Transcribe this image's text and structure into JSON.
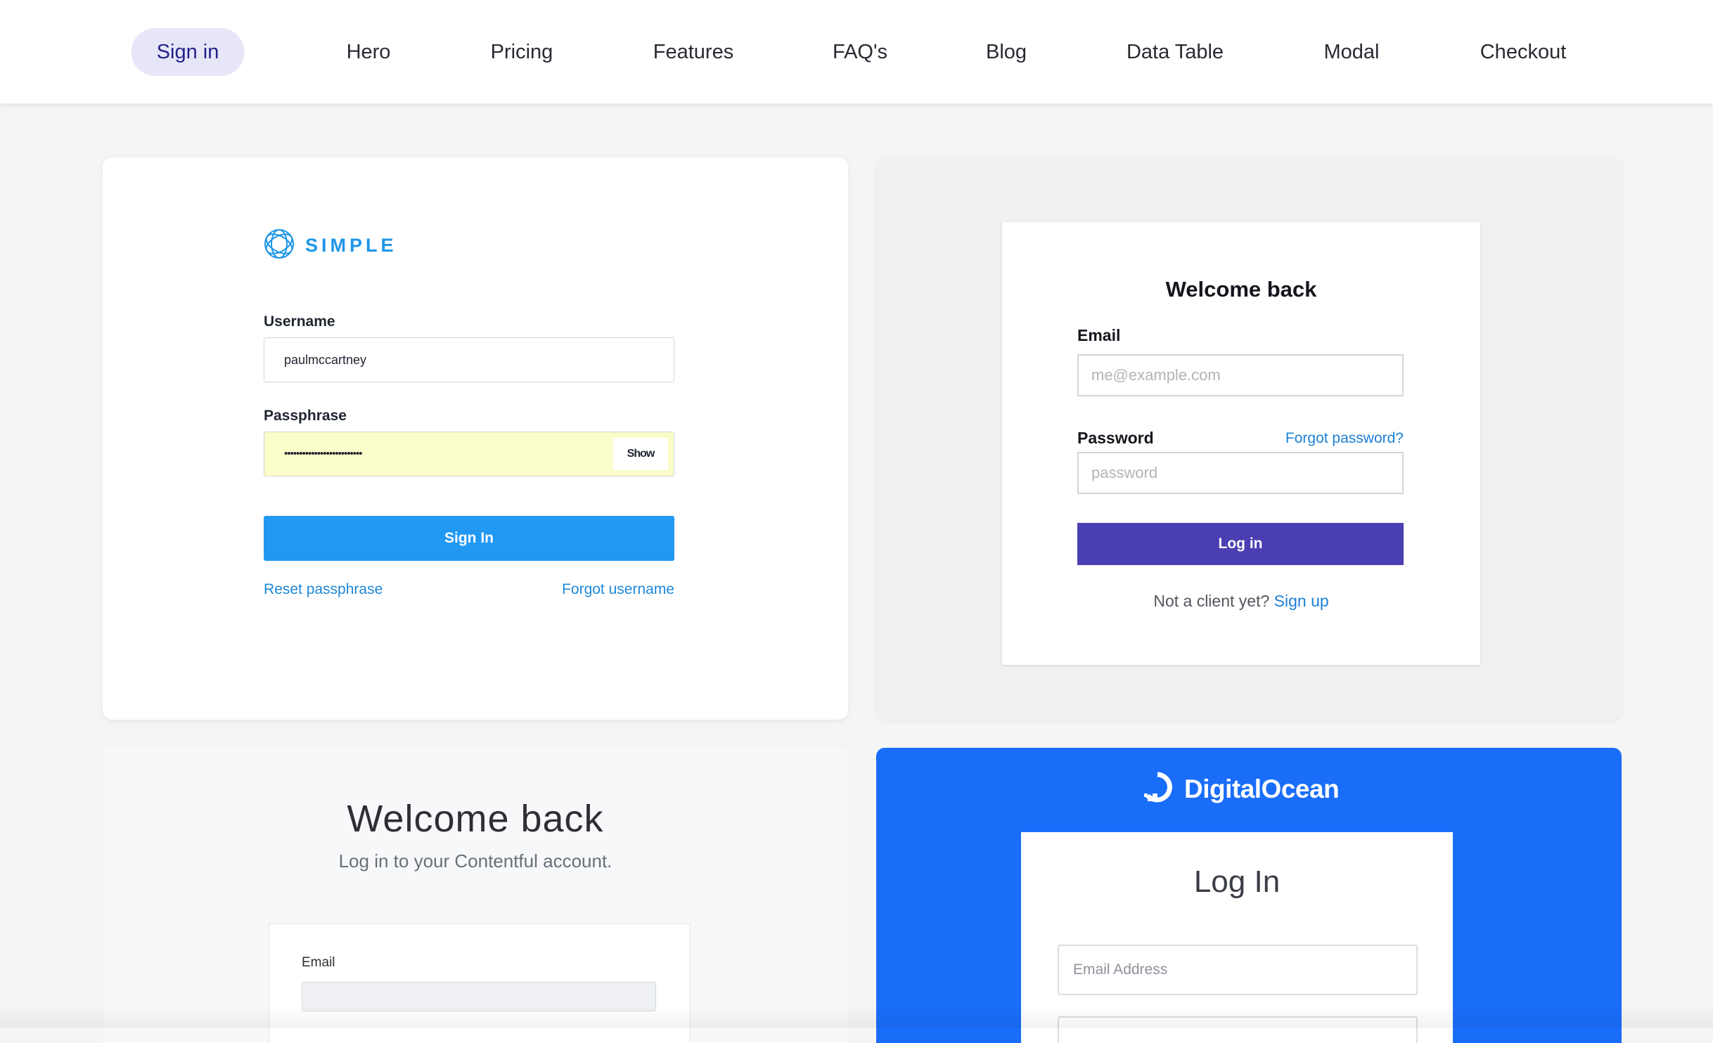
{
  "nav": {
    "items": [
      {
        "label": "Sign in",
        "active": true
      },
      {
        "label": "Hero"
      },
      {
        "label": "Pricing"
      },
      {
        "label": "Features"
      },
      {
        "label": "FAQ's"
      },
      {
        "label": "Blog"
      },
      {
        "label": "Data Table"
      },
      {
        "label": "Modal"
      },
      {
        "label": "Checkout"
      }
    ]
  },
  "simple": {
    "brand": "SIMPLE",
    "username_label": "Username",
    "username_value": "paulmccartney",
    "passphrase_label": "Passphrase",
    "passphrase_value": "••••••••••••••••••••••••••",
    "show_label": "Show",
    "signin_label": "Sign In",
    "reset_link": "Reset passphrase",
    "forgot_link": "Forgot username",
    "brand_color": "#1e96e8",
    "button_color": "#2199f3"
  },
  "welcome": {
    "title": "Welcome back",
    "email_label": "Email",
    "email_placeholder": "me@example.com",
    "password_label": "Password",
    "forgot_password": "Forgot password?",
    "password_placeholder": "password",
    "login_label": "Log in",
    "footer_text": "Not a client yet?",
    "signup_link": "Sign up",
    "button_color": "#4a3fb2"
  },
  "contentful": {
    "title": "Welcome back",
    "subtitle": "Log in to your Contentful account.",
    "email_label": "Email"
  },
  "digitalocean": {
    "brand": "DigitalOcean",
    "title": "Log In",
    "email_placeholder": "Email Address",
    "bg_color": "#1a6df9"
  }
}
